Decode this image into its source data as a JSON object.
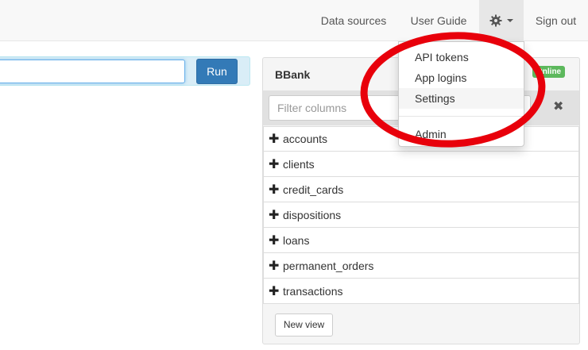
{
  "navbar": {
    "data_sources": "Data sources",
    "user_guide": "User Guide",
    "sign_out": "Sign out"
  },
  "query": {
    "input_value": "",
    "run_label": "Run"
  },
  "db_panel": {
    "title": "BBank",
    "status_badge": "Online",
    "filter_placeholder": "Filter columns",
    "tables": [
      {
        "name": "accounts"
      },
      {
        "name": "clients"
      },
      {
        "name": "credit_cards"
      },
      {
        "name": "dispositions"
      },
      {
        "name": "loans"
      },
      {
        "name": "permanent_orders"
      },
      {
        "name": "transactions"
      }
    ],
    "new_view_label": "New view"
  },
  "dropdown": {
    "items": [
      {
        "label": "API tokens"
      },
      {
        "label": "App logins"
      },
      {
        "label": "Settings"
      },
      {
        "label": "Admin"
      }
    ]
  },
  "colors": {
    "primary": "#337ab7",
    "online": "#5cb85c",
    "annotation": "#e8000b"
  }
}
